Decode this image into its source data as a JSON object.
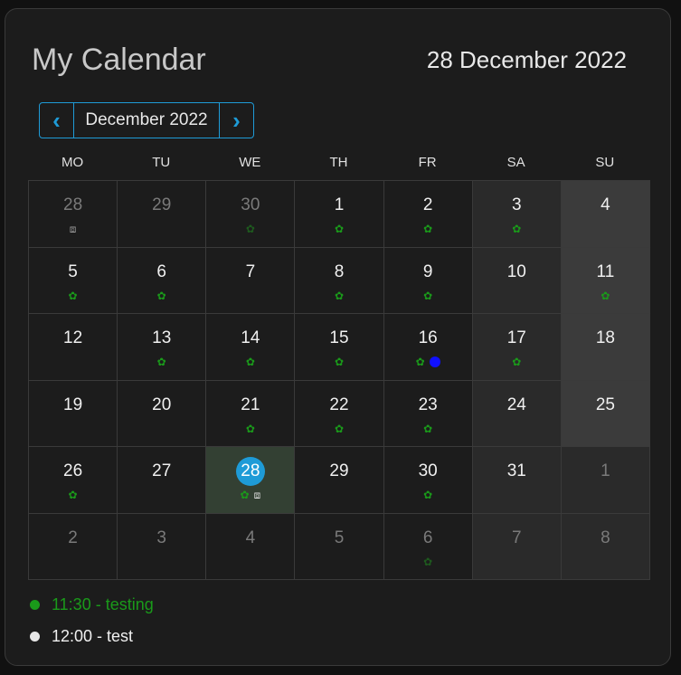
{
  "header": {
    "title": "My Calendar",
    "current_date": "28 December 2022"
  },
  "nav": {
    "prev_icon": "chevron-left-icon",
    "next_icon": "chevron-right-icon",
    "month_label": "December 2022"
  },
  "weekdays": [
    "MO",
    "TU",
    "WE",
    "TH",
    "FR",
    "SA",
    "SU"
  ],
  "colors": {
    "accent": "#1e9bd7",
    "event_green": "#1a9a1a",
    "event_blue": "#1010ff",
    "event_white": "#e8e8e8"
  },
  "days": [
    {
      "label": "28",
      "other": true,
      "ind": [
        "box"
      ]
    },
    {
      "label": "29",
      "other": true,
      "ind": []
    },
    {
      "label": "30",
      "other": true,
      "ind": [
        "flower"
      ]
    },
    {
      "label": "1",
      "ind": [
        "flower"
      ]
    },
    {
      "label": "2",
      "ind": [
        "flower"
      ]
    },
    {
      "label": "3",
      "ind": [
        "flower"
      ]
    },
    {
      "label": "4",
      "ind": []
    },
    {
      "label": "5",
      "ind": [
        "flower"
      ]
    },
    {
      "label": "6",
      "ind": [
        "flower"
      ]
    },
    {
      "label": "7",
      "ind": []
    },
    {
      "label": "8",
      "ind": [
        "flower"
      ]
    },
    {
      "label": "9",
      "ind": [
        "flower"
      ]
    },
    {
      "label": "10",
      "ind": []
    },
    {
      "label": "11",
      "ind": [
        "flower"
      ]
    },
    {
      "label": "12",
      "ind": []
    },
    {
      "label": "13",
      "ind": [
        "flower"
      ]
    },
    {
      "label": "14",
      "ind": [
        "flower"
      ]
    },
    {
      "label": "15",
      "ind": [
        "flower"
      ]
    },
    {
      "label": "16",
      "ind": [
        "flower",
        "blue"
      ]
    },
    {
      "label": "17",
      "ind": [
        "flower"
      ]
    },
    {
      "label": "18",
      "ind": []
    },
    {
      "label": "19",
      "ind": []
    },
    {
      "label": "20",
      "ind": []
    },
    {
      "label": "21",
      "ind": [
        "flower"
      ]
    },
    {
      "label": "22",
      "ind": [
        "flower"
      ]
    },
    {
      "label": "23",
      "ind": [
        "flower"
      ]
    },
    {
      "label": "24",
      "ind": []
    },
    {
      "label": "25",
      "ind": []
    },
    {
      "label": "26",
      "ind": [
        "flower"
      ]
    },
    {
      "label": "27",
      "ind": []
    },
    {
      "label": "28",
      "today": true,
      "ind": [
        "flower",
        "box"
      ]
    },
    {
      "label": "29",
      "ind": []
    },
    {
      "label": "30",
      "ind": [
        "flower"
      ]
    },
    {
      "label": "31",
      "ind": []
    },
    {
      "label": "1",
      "other": true,
      "ind": []
    },
    {
      "label": "2",
      "other": true,
      "ind": []
    },
    {
      "label": "3",
      "other": true,
      "ind": []
    },
    {
      "label": "4",
      "other": true,
      "ind": []
    },
    {
      "label": "5",
      "other": true,
      "ind": []
    },
    {
      "label": "6",
      "other": true,
      "ind": [
        "flower"
      ]
    },
    {
      "label": "7",
      "other": true,
      "ind": []
    },
    {
      "label": "8",
      "other": true,
      "ind": []
    }
  ],
  "events": [
    {
      "text": "11:30 - testing",
      "color": "#1a9a1a",
      "text_color": "#1a9a1a"
    },
    {
      "text": "12:00 - test",
      "color": "#e8e8e8",
      "text_color": "#f0f0f0"
    }
  ]
}
